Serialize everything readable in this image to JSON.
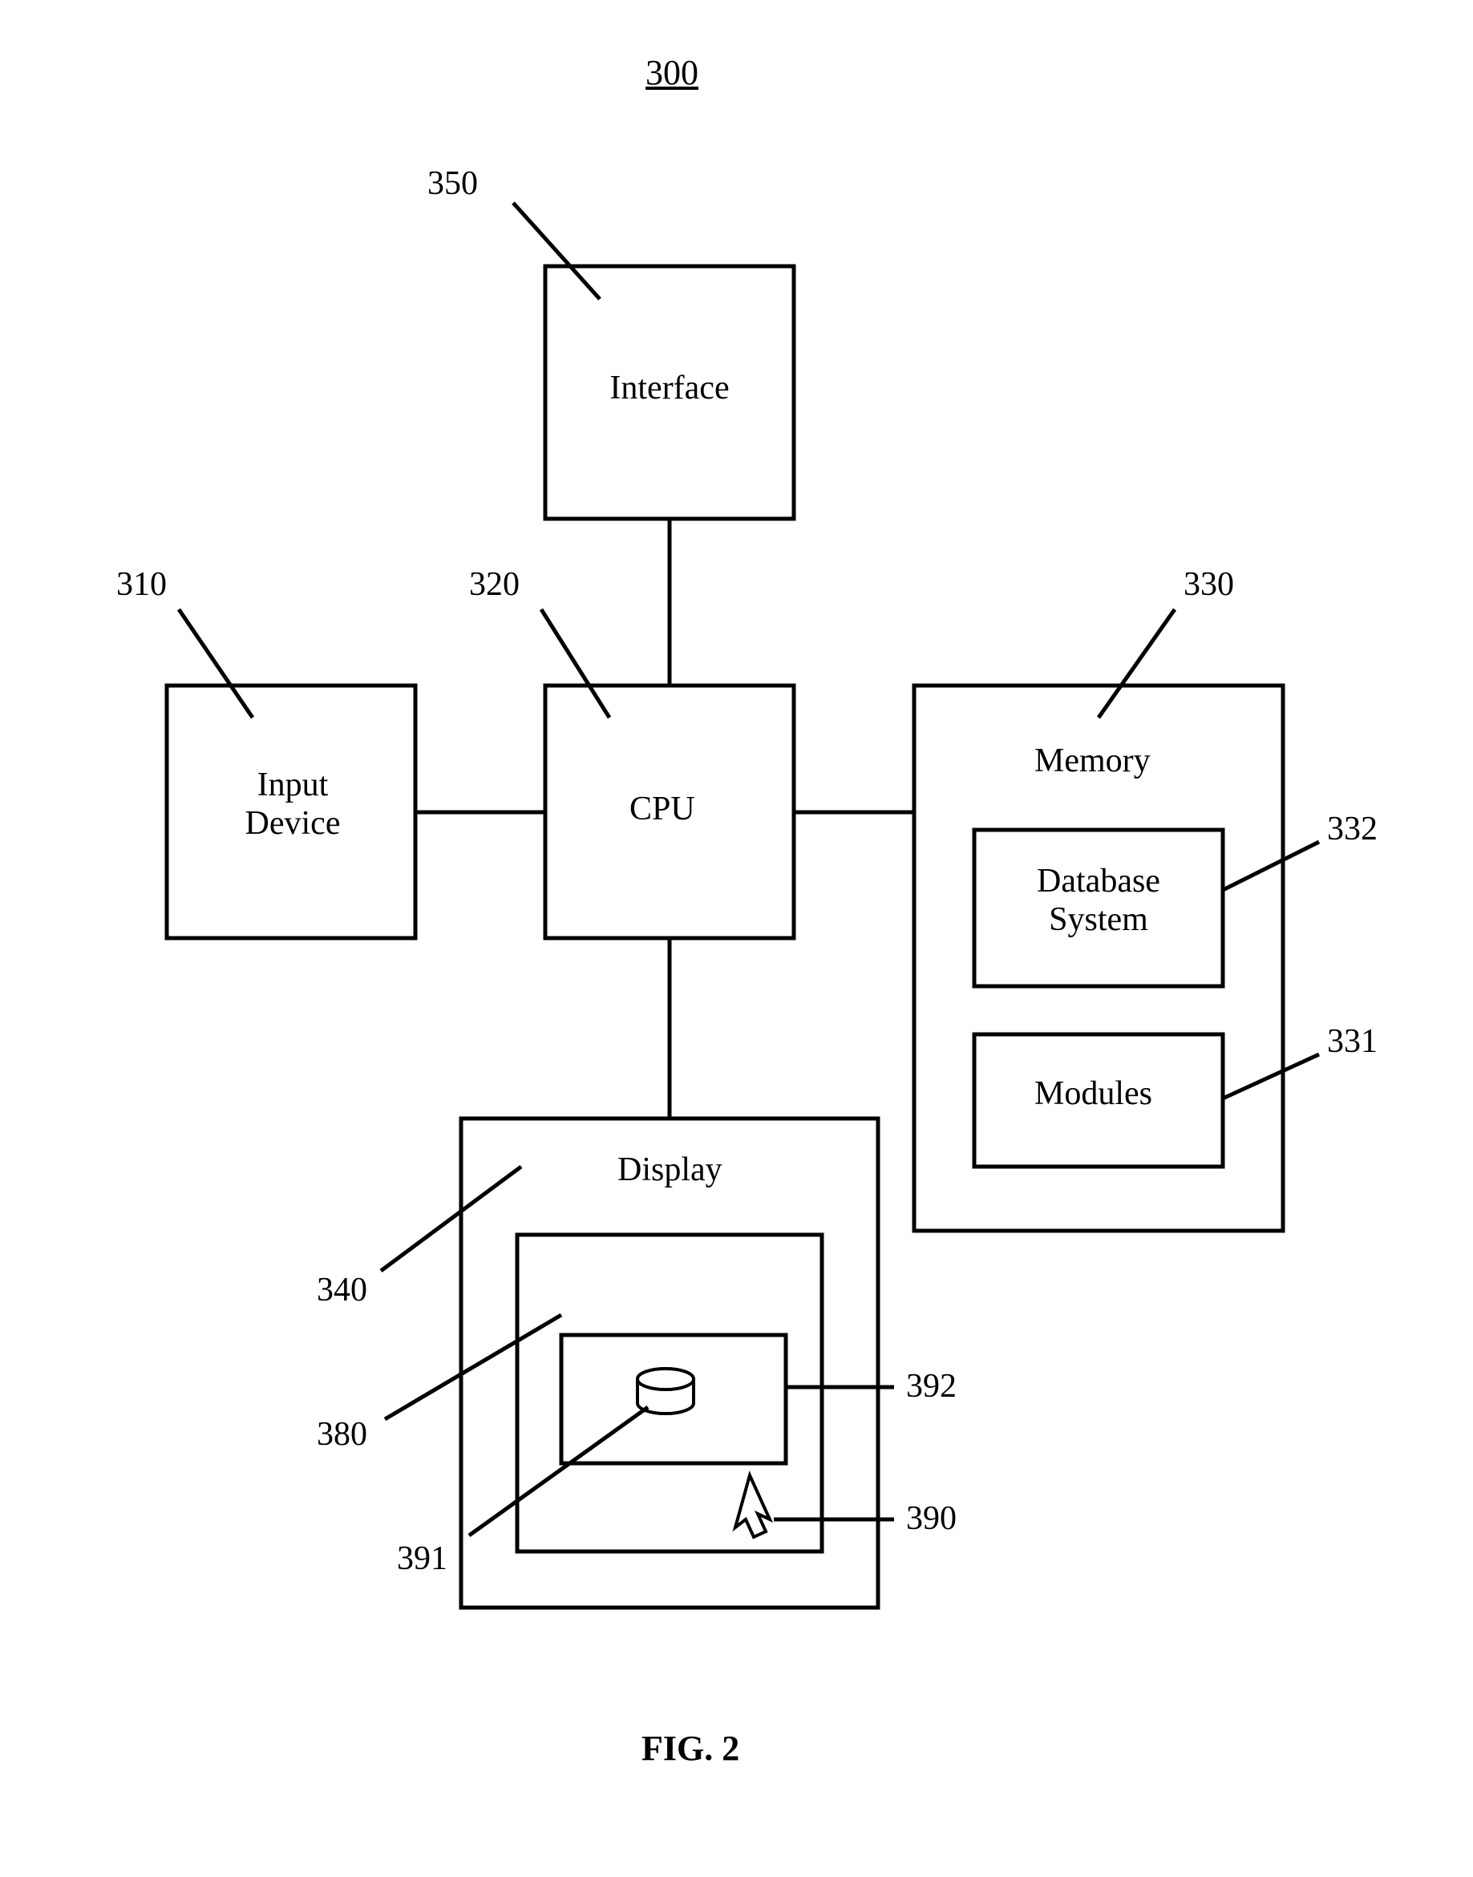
{
  "figure": {
    "number": "300",
    "caption": "FIG. 2"
  },
  "blocks": {
    "interface": {
      "label": "Interface",
      "ref": "350"
    },
    "input_device": {
      "label": "Input\nDevice",
      "ref": "310"
    },
    "cpu": {
      "label": "CPU",
      "ref": "320"
    },
    "memory": {
      "label": "Memory",
      "ref": "330"
    },
    "database_system": {
      "label": "Database\nSystem",
      "ref": "332"
    },
    "modules": {
      "label": "Modules",
      "ref": "331"
    },
    "display": {
      "label": "Display",
      "ref": "340"
    },
    "window_outer": {
      "ref": "380"
    },
    "window_inner": {
      "ref": "392"
    },
    "cylinder": {
      "ref": "391"
    },
    "cursor": {
      "ref": "390"
    }
  }
}
